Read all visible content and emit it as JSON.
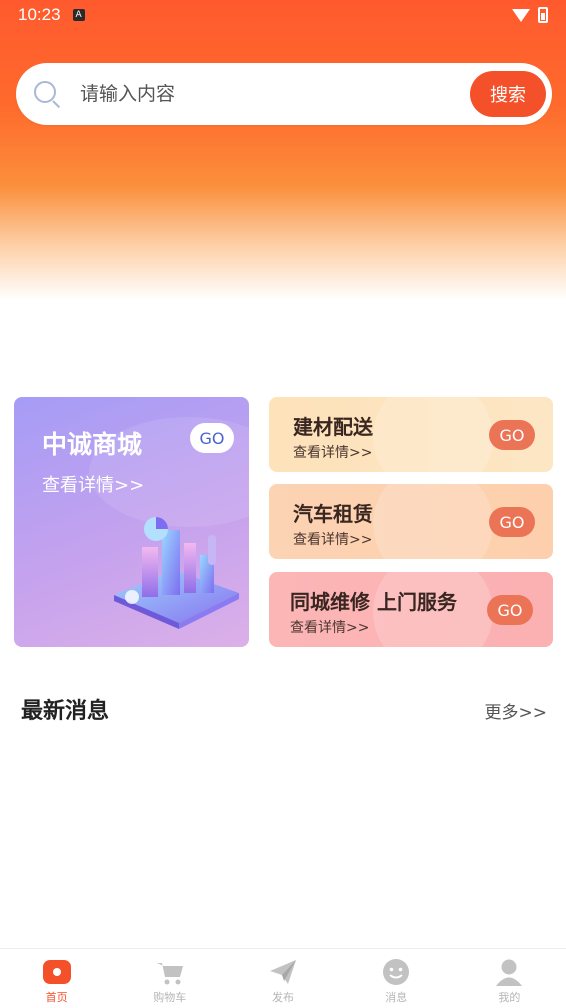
{
  "status_bar": {
    "time": "10:23",
    "badge": "A"
  },
  "search": {
    "placeholder": "请输入内容",
    "button_label": "搜索"
  },
  "feature_cards": {
    "main": {
      "title": "中诚商城",
      "subtitle": "查看详情>>",
      "go": "GO"
    },
    "items": [
      {
        "title": "建材配送",
        "subtitle": "查看详情>>",
        "go": "GO"
      },
      {
        "title": "汽车租赁",
        "subtitle": "查看详情>>",
        "go": "GO"
      },
      {
        "title": "同城维修 上门服务",
        "subtitle": "查看详情>>",
        "go": "GO"
      }
    ]
  },
  "news": {
    "title": "最新消息",
    "more": "更多>>"
  },
  "tabbar": {
    "tabs": [
      {
        "label": "首页",
        "icon": "home-icon",
        "active": true
      },
      {
        "label": "购物车",
        "icon": "cart-icon",
        "active": false
      },
      {
        "label": "发布",
        "icon": "send-icon",
        "active": false
      },
      {
        "label": "消息",
        "icon": "message-icon",
        "active": false
      },
      {
        "label": "我的",
        "icon": "profile-icon",
        "active": false
      }
    ]
  },
  "colors": {
    "accent": "#f4512b",
    "inactive": "#b5b5b5"
  }
}
